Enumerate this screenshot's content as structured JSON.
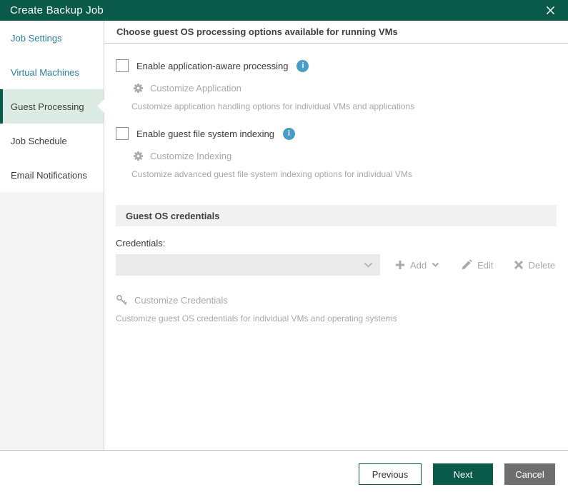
{
  "titlebar": {
    "title": "Create Backup Job"
  },
  "sidebar": {
    "items": [
      {
        "label": "Job Settings",
        "state": "link"
      },
      {
        "label": "Virtual Machines",
        "state": "link"
      },
      {
        "label": "Guest Processing",
        "state": "active"
      },
      {
        "label": "Job Schedule",
        "state": "plain"
      },
      {
        "label": "Email Notifications",
        "state": "plain"
      }
    ]
  },
  "main": {
    "heading": "Choose guest OS processing options available for running VMs",
    "app_aware": {
      "checkbox_label": "Enable application-aware processing",
      "checkbox_checked": false,
      "customize_label": "Customize Application",
      "description": "Customize application handling options for individual VMs and applications"
    },
    "indexing": {
      "checkbox_label": "Enable guest file system indexing",
      "checkbox_checked": false,
      "customize_label": "Customize Indexing",
      "description": "Customize advanced guest file system indexing options for individual VMs"
    },
    "credentials": {
      "section_heading": "Guest OS credentials",
      "field_label": "Credentials:",
      "select_value": "",
      "add_label": "Add",
      "edit_label": "Edit",
      "delete_label": "Delete",
      "customize_label": "Customize Credentials",
      "description": "Customize guest OS credentials for individual VMs and operating systems"
    }
  },
  "footer": {
    "previous_label": "Previous",
    "next_label": "Next",
    "cancel_label": "Cancel"
  },
  "icons": {
    "close": "x-cross",
    "info": "info-circle",
    "customize_app": "gear",
    "customize_indexing": "gear",
    "customize_credentials": "key",
    "add": "plus",
    "add_menu": "chevron-down",
    "edit": "pencil",
    "delete": "x-cross",
    "select": "chevron-down",
    "active_step": "left-notch-arrow"
  },
  "colors": {
    "brand_green": "#095a49",
    "active_item_bg": "#dcebe4",
    "link_blue": "#2b7fa8",
    "info_blue": "#4a9cc6",
    "disabled_gray": "#a9a9a9",
    "description_gray": "#a8a8a8",
    "section_bar_bg": "#f1f1f1",
    "select_bg": "#ebebeb",
    "cancel_gray": "#6e6e6e",
    "sidebar_bg": "#f4f4f4"
  }
}
